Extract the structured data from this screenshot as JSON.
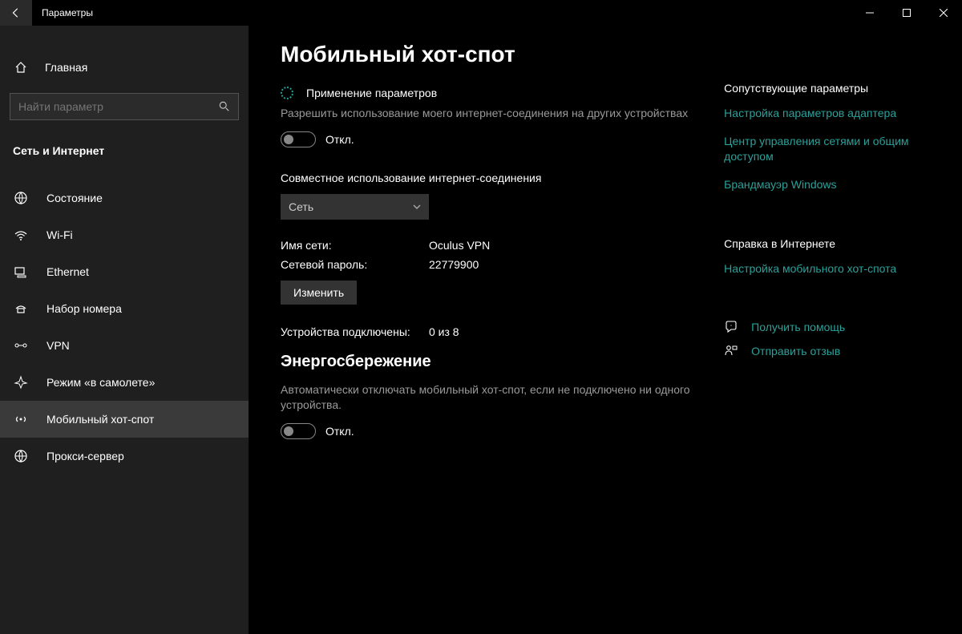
{
  "title_bar": {
    "app_title": "Параметры"
  },
  "sidebar": {
    "home_label": "Главная",
    "search_placeholder": "Найти параметр",
    "category_label": "Сеть и Интернет",
    "items": [
      {
        "label": "Состояние"
      },
      {
        "label": "Wi-Fi"
      },
      {
        "label": "Ethernet"
      },
      {
        "label": "Набор номера"
      },
      {
        "label": "VPN"
      },
      {
        "label": "Режим «в самолете»"
      },
      {
        "label": "Мобильный хот-спот"
      },
      {
        "label": "Прокси-сервер"
      }
    ]
  },
  "main": {
    "page_title": "Мобильный хот-спот",
    "status_label": "Применение параметров",
    "share_desc": "Разрешить использование моего интернет-соединения на других устройствах",
    "toggle1_label": "Откл.",
    "share_from_label": "Совместное использование интернет-соединения",
    "share_from_value": "Сеть",
    "network_name_k": "Имя сети:",
    "network_name_v": "Oculus VPN",
    "network_pass_k": "Сетевой пароль:",
    "network_pass_v": "22779900",
    "edit_btn": "Изменить",
    "devices_k": "Устройства подключены:",
    "devices_v": "0 из 8",
    "power_title": "Энергосбережение",
    "power_desc": "Автоматически отключать мобильный хот-спот, если не подключено ни одного устройства.",
    "toggle2_label": "Откл."
  },
  "side_panel": {
    "related_head": "Сопутствующие параметры",
    "related": [
      "Настройка параметров адаптера",
      "Центр управления сетями и общим доступом",
      "Брандмауэр Windows"
    ],
    "help_head": "Справка в Интернете",
    "help_links": [
      "Настройка мобильного хот-спота"
    ],
    "actions": [
      {
        "label": "Получить помощь"
      },
      {
        "label": "Отправить отзыв"
      }
    ]
  }
}
